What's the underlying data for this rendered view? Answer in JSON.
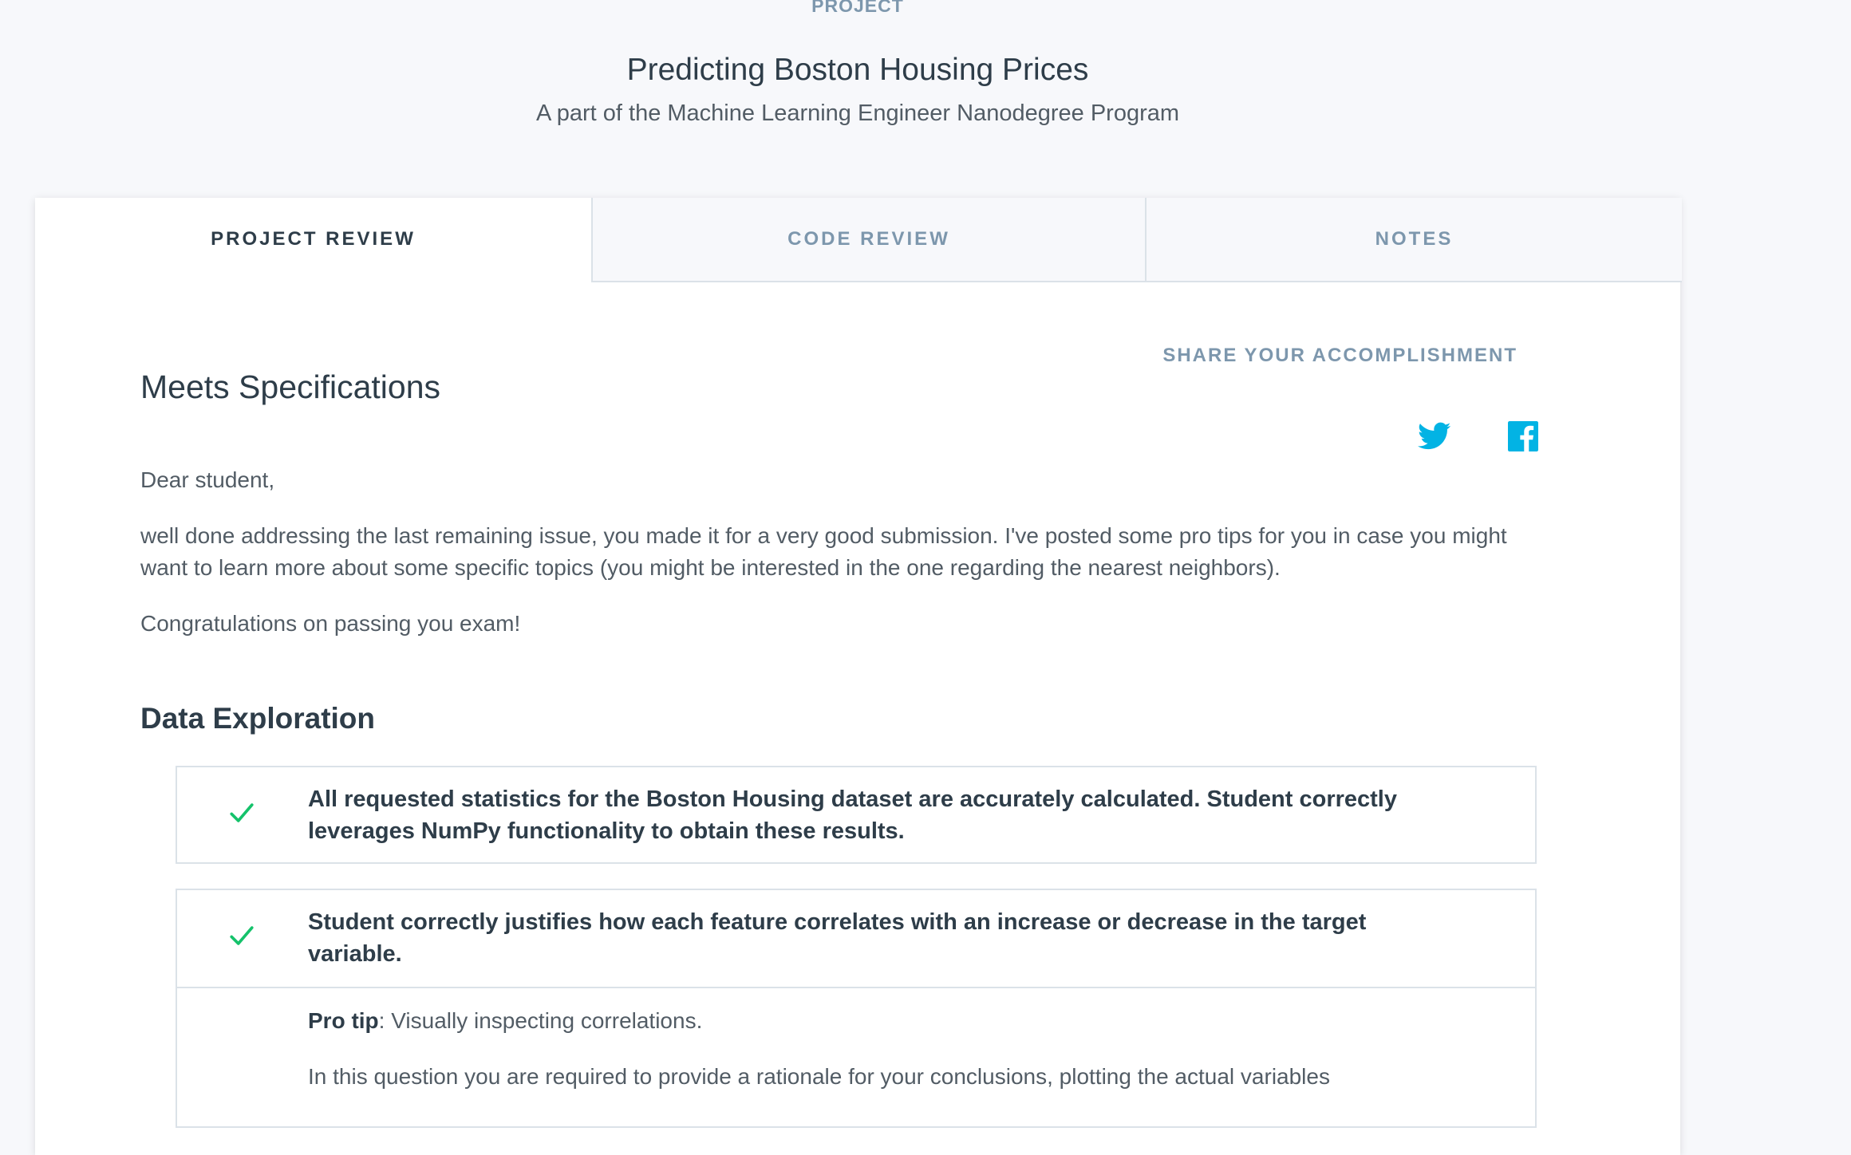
{
  "header": {
    "eyebrow": "PROJECT",
    "title": "Predicting Boston Housing Prices",
    "subtitle": "A part of the Machine Learning Engineer Nanodegree Program"
  },
  "tabs": [
    {
      "label": "PROJECT REVIEW",
      "active": true
    },
    {
      "label": "CODE REVIEW",
      "active": false
    },
    {
      "label": "NOTES",
      "active": false
    }
  ],
  "review": {
    "status": "Meets Specifications",
    "share_label": "SHARE YOUR ACCOMPLISHMENT",
    "social": [
      "twitter-icon",
      "facebook-icon"
    ],
    "paragraphs": [
      "Dear student,",
      "well done addressing the last remaining issue, you made it for a very good submission. I've posted some pro tips for you in case you might want to learn more about some specific topics (you might be interested in the one regarding the nearest neighbors).",
      "Congratulations on passing you exam!"
    ]
  },
  "section": {
    "title": "Data Exploration",
    "criteria": [
      {
        "text": "All requested statistics for the Boston Housing dataset are accurately calculated. Student correctly leverages NumPy functionality to obtain these results.",
        "met": true
      },
      {
        "text": "Student correctly justifies how each feature correlates with an increase or decrease in the target variable.",
        "met": true
      }
    ],
    "tip": {
      "label": "Pro tip",
      "text": ": Visually inspecting correlations.",
      "body": "In this question you are required to provide a rationale for your conclusions, plotting the actual variables"
    }
  },
  "colors": {
    "accent_blue": "#02b3e4",
    "check_green": "#15c26b",
    "muted": "#7d97ad"
  }
}
